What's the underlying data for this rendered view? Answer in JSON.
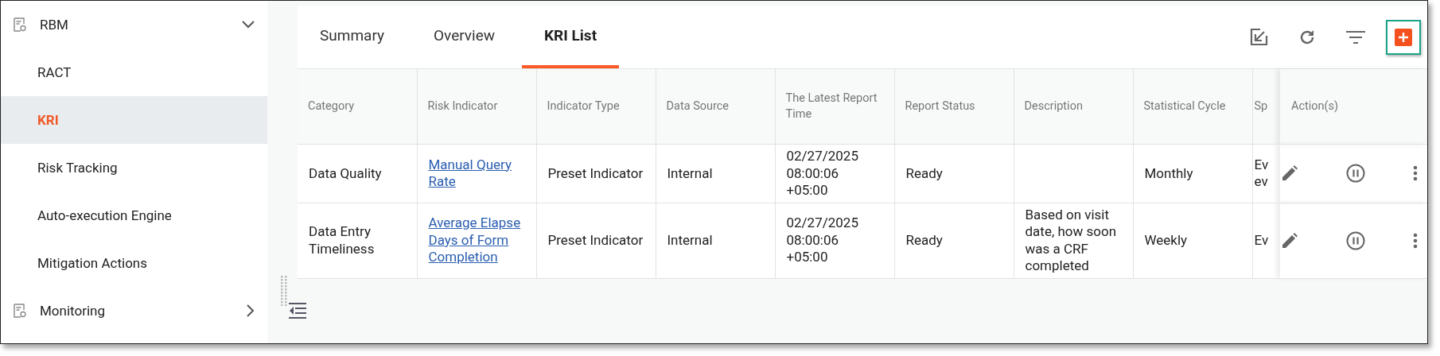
{
  "sidebar": {
    "items": [
      {
        "label": "RBM",
        "expanded": true,
        "children": [
          {
            "label": "RACT",
            "selected": false
          },
          {
            "label": "KRI",
            "selected": true
          },
          {
            "label": "Risk Tracking",
            "selected": false
          },
          {
            "label": "Auto-execution Engine",
            "selected": false
          },
          {
            "label": "Mitigation Actions",
            "selected": false
          }
        ]
      },
      {
        "label": "Monitoring",
        "expanded": false
      }
    ]
  },
  "tabs": [
    {
      "label": "Summary",
      "selected": false
    },
    {
      "label": "Overview",
      "selected": false
    },
    {
      "label": "KRI List",
      "selected": true
    }
  ],
  "toolbar": {
    "add_button": {
      "highlighted": true
    }
  },
  "table": {
    "columns": [
      "Category",
      "Risk Indicator",
      "Indicator Type",
      "Data Source",
      "The Latest Report Time",
      "Report Status",
      "Description",
      "Statistical Cycle",
      "Sp"
    ],
    "actions_column": "Action(s)",
    "rows": [
      {
        "category": "Data Quality",
        "risk_indicator": "Manual Query Rate",
        "indicator_type": "Preset Indicator",
        "data_source": "Internal",
        "latest_report_time": "02/27/2025 08:00:06 +05:00",
        "report_status": "Ready",
        "statistical_cycle": "Monthly",
        "column_9": "Ev ev"
      },
      {
        "category": "Data Entry Timeliness",
        "risk_indicator": "Average Elapse Days of Form Completion",
        "indicator_type": "Preset Indicator",
        "data_source": "Internal",
        "latest_report_time": "02/27/2025 08:00:06 +05:00",
        "report_status": "Ready",
        "description": "Based on visit date, how soon was a CRF completed",
        "statistical_cycle": "Weekly",
        "column_9": "Ev"
      }
    ]
  }
}
